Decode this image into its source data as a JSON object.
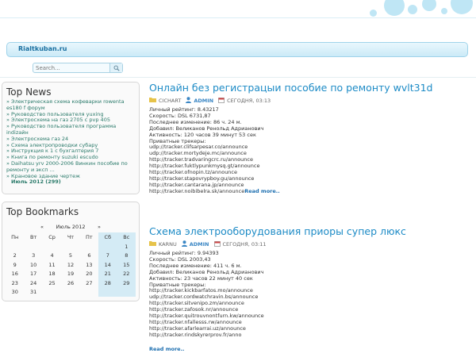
{
  "site": {
    "brand": "Rialtkuban.ru"
  },
  "search": {
    "placeholder": "Search..."
  },
  "news": {
    "title": "Top News",
    "items": [
      "» Электрическая схема кофеварки rowenta es180 f форум",
      "» Руководство пользователя yuxing",
      "» Электросхема на газ 2705 с pvp 405",
      "» Руководство пользователя программа indizaйн",
      "» Электросхема газ 24",
      "» Схема электропроводки субару",
      "» Инструкция к 1 с бухгалтерия 7",
      "» Книга по ремонту suzuki escudo",
      "» Daihatsu yrv 2000-2006 Βинкин пособие по ремонту и эксп ...",
      "» Крановое здание чертеж"
    ],
    "archive": "Июль 2012 (299)"
  },
  "bookmarks": {
    "title": "Top Bookmarks",
    "prev": "«",
    "month": "Июль 2012",
    "next": "»",
    "weekdays": [
      "Пн",
      "Вт",
      "Ср",
      "Чт",
      "Пт",
      "Сб",
      "Вс"
    ],
    "weeks": [
      [
        "",
        "",
        "",
        "",
        "",
        "",
        "1"
      ],
      [
        "2",
        "3",
        "4",
        "5",
        "6",
        "7",
        "8"
      ],
      [
        "9",
        "10",
        "11",
        "12",
        "13",
        "14",
        "15"
      ],
      [
        "16",
        "17",
        "18",
        "19",
        "20",
        "21",
        "22"
      ],
      [
        "23",
        "24",
        "25",
        "26",
        "27",
        "28",
        "29"
      ],
      [
        "30",
        "31",
        "",
        "",
        "",
        "",
        ""
      ]
    ]
  },
  "posts": [
    {
      "title": "Онлайн без регистрацыи пособие по ремонту wvlt31d",
      "category": "CICHART",
      "author": "ADMIN",
      "date": "СЕГОДНЯ, 03:13",
      "lines": [
        "Личный рейтинг: 8.43217",
        "Скорость: DSL 6731,87",
        "Последнее изменение: 86 ч. 24 м.",
        "Добавил: Великанов Ренольд Адрианович",
        "Активность: 120 часов 39 минут 53 сек",
        "Приватные трекеры:",
        "udp://tracker.clifsarpesar.co/announce",
        "udp://tracker.mortydeje.mc/announce",
        "http://tracker.tradvaringcrc.ru/announce",
        "http://tracker.fuktlypunkmysq.gt/announce",
        "http://tracker.ofnopin.tz/announce",
        "http://tracker.stapovrypboy.gu/announce",
        "http://tracker.cantarana.jp/announce"
      ],
      "last_line": "http://tracker.noibibelra.sk/announce",
      "readmore": "Read more.."
    },
    {
      "title": "Схема электрооборудования приоры супер люкс",
      "category": "KARNU",
      "author": "ADMIN",
      "date": "СЕГОДНЯ, 03:11",
      "lines": [
        "Личный рейтинг: 9.94393",
        "Скорость: DSL 2003,43",
        "Последнее изменение: 411 ч. 6 м.",
        "Добавил: Великанов Ренольд Адрианович",
        "Активность: 23 часов 22 минут 40 сек",
        "Приватные трекеры:",
        "http://tracker.kickbarfatos.mo/announce",
        "udp://tracker.cordwatchravin.bs/announce",
        "http://tracker.sitvenipo.zm/announce",
        "http://tracker.zafosok.nr/announce",
        "http://tracker.quitrouvnontfurn.kw/announce",
        "http://tracker.nfallesss.rw/announce",
        "http://tracker.afarlearrai.uz/announce",
        "http://tracker.rindskyrerprov.fr/anno"
      ],
      "readmore": "Read more.."
    }
  ],
  "colors": {
    "accent": "#1d8bc6",
    "header_bar": "#cbeaf7",
    "weekend": "#d4ebf5"
  }
}
